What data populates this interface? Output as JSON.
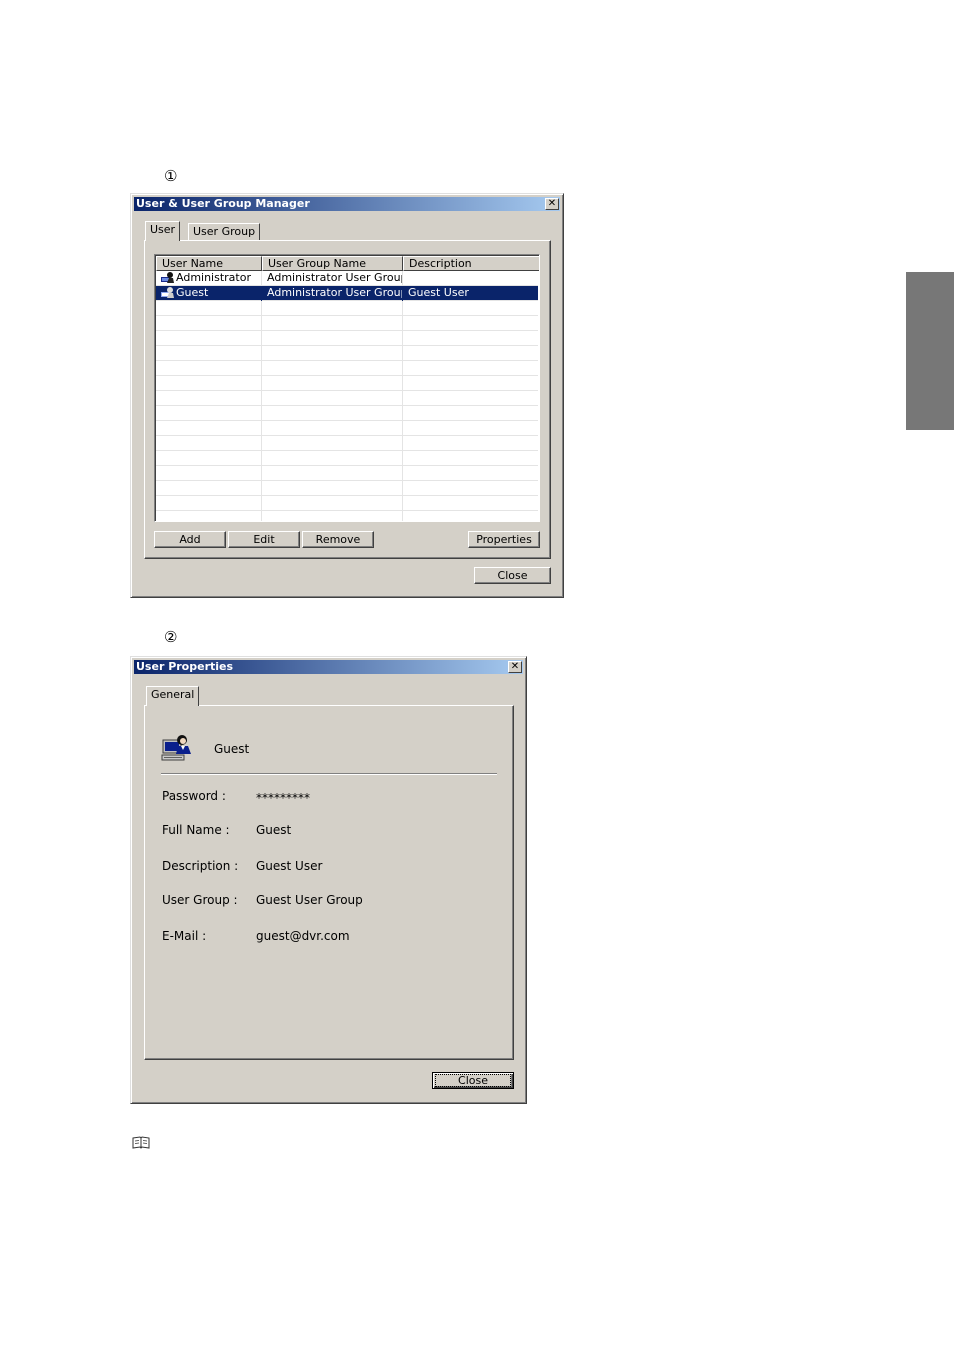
{
  "markers": {
    "first": "①",
    "second": "②"
  },
  "manager": {
    "title": "User & User Group Manager",
    "close_glyph": "✕",
    "tabs": [
      {
        "label": "User"
      },
      {
        "label": "User Group"
      }
    ],
    "columns": [
      "User Name",
      "User Group Name",
      "Description"
    ],
    "rows": [
      {
        "user": "Administrator",
        "group": "Administrator User Group",
        "description": "",
        "icon": "user-icon",
        "selected": false
      },
      {
        "user": "Guest",
        "group": "Administrator User Group",
        "description": "Guest User",
        "icon": "user-icon",
        "selected": true
      }
    ],
    "buttons": {
      "add": "Add",
      "edit": "Edit",
      "remove": "Remove",
      "properties": "Properties"
    },
    "close_label": "Close"
  },
  "properties": {
    "title": "User Properties",
    "close_glyph": "✕",
    "tab": "General",
    "user_icon": "user-computer-icon",
    "user_name": "Guest",
    "fields": [
      {
        "label": "Password :",
        "value": "*********"
      },
      {
        "label": "Full Name :",
        "value": "Guest"
      },
      {
        "label": "Description :",
        "value": "Guest User"
      },
      {
        "label": "User Group :",
        "value": "Guest User Group"
      },
      {
        "label": "E-Mail :",
        "value": "guest@dvr.com"
      }
    ],
    "close_label": "Close"
  },
  "note_icon": "book-icon",
  "colors": {
    "selection": "#0a246a",
    "titlebar_start": "#0a246a",
    "titlebar_end": "#a6caf0",
    "face": "#d4d0c8",
    "side_tab": "#777777"
  }
}
